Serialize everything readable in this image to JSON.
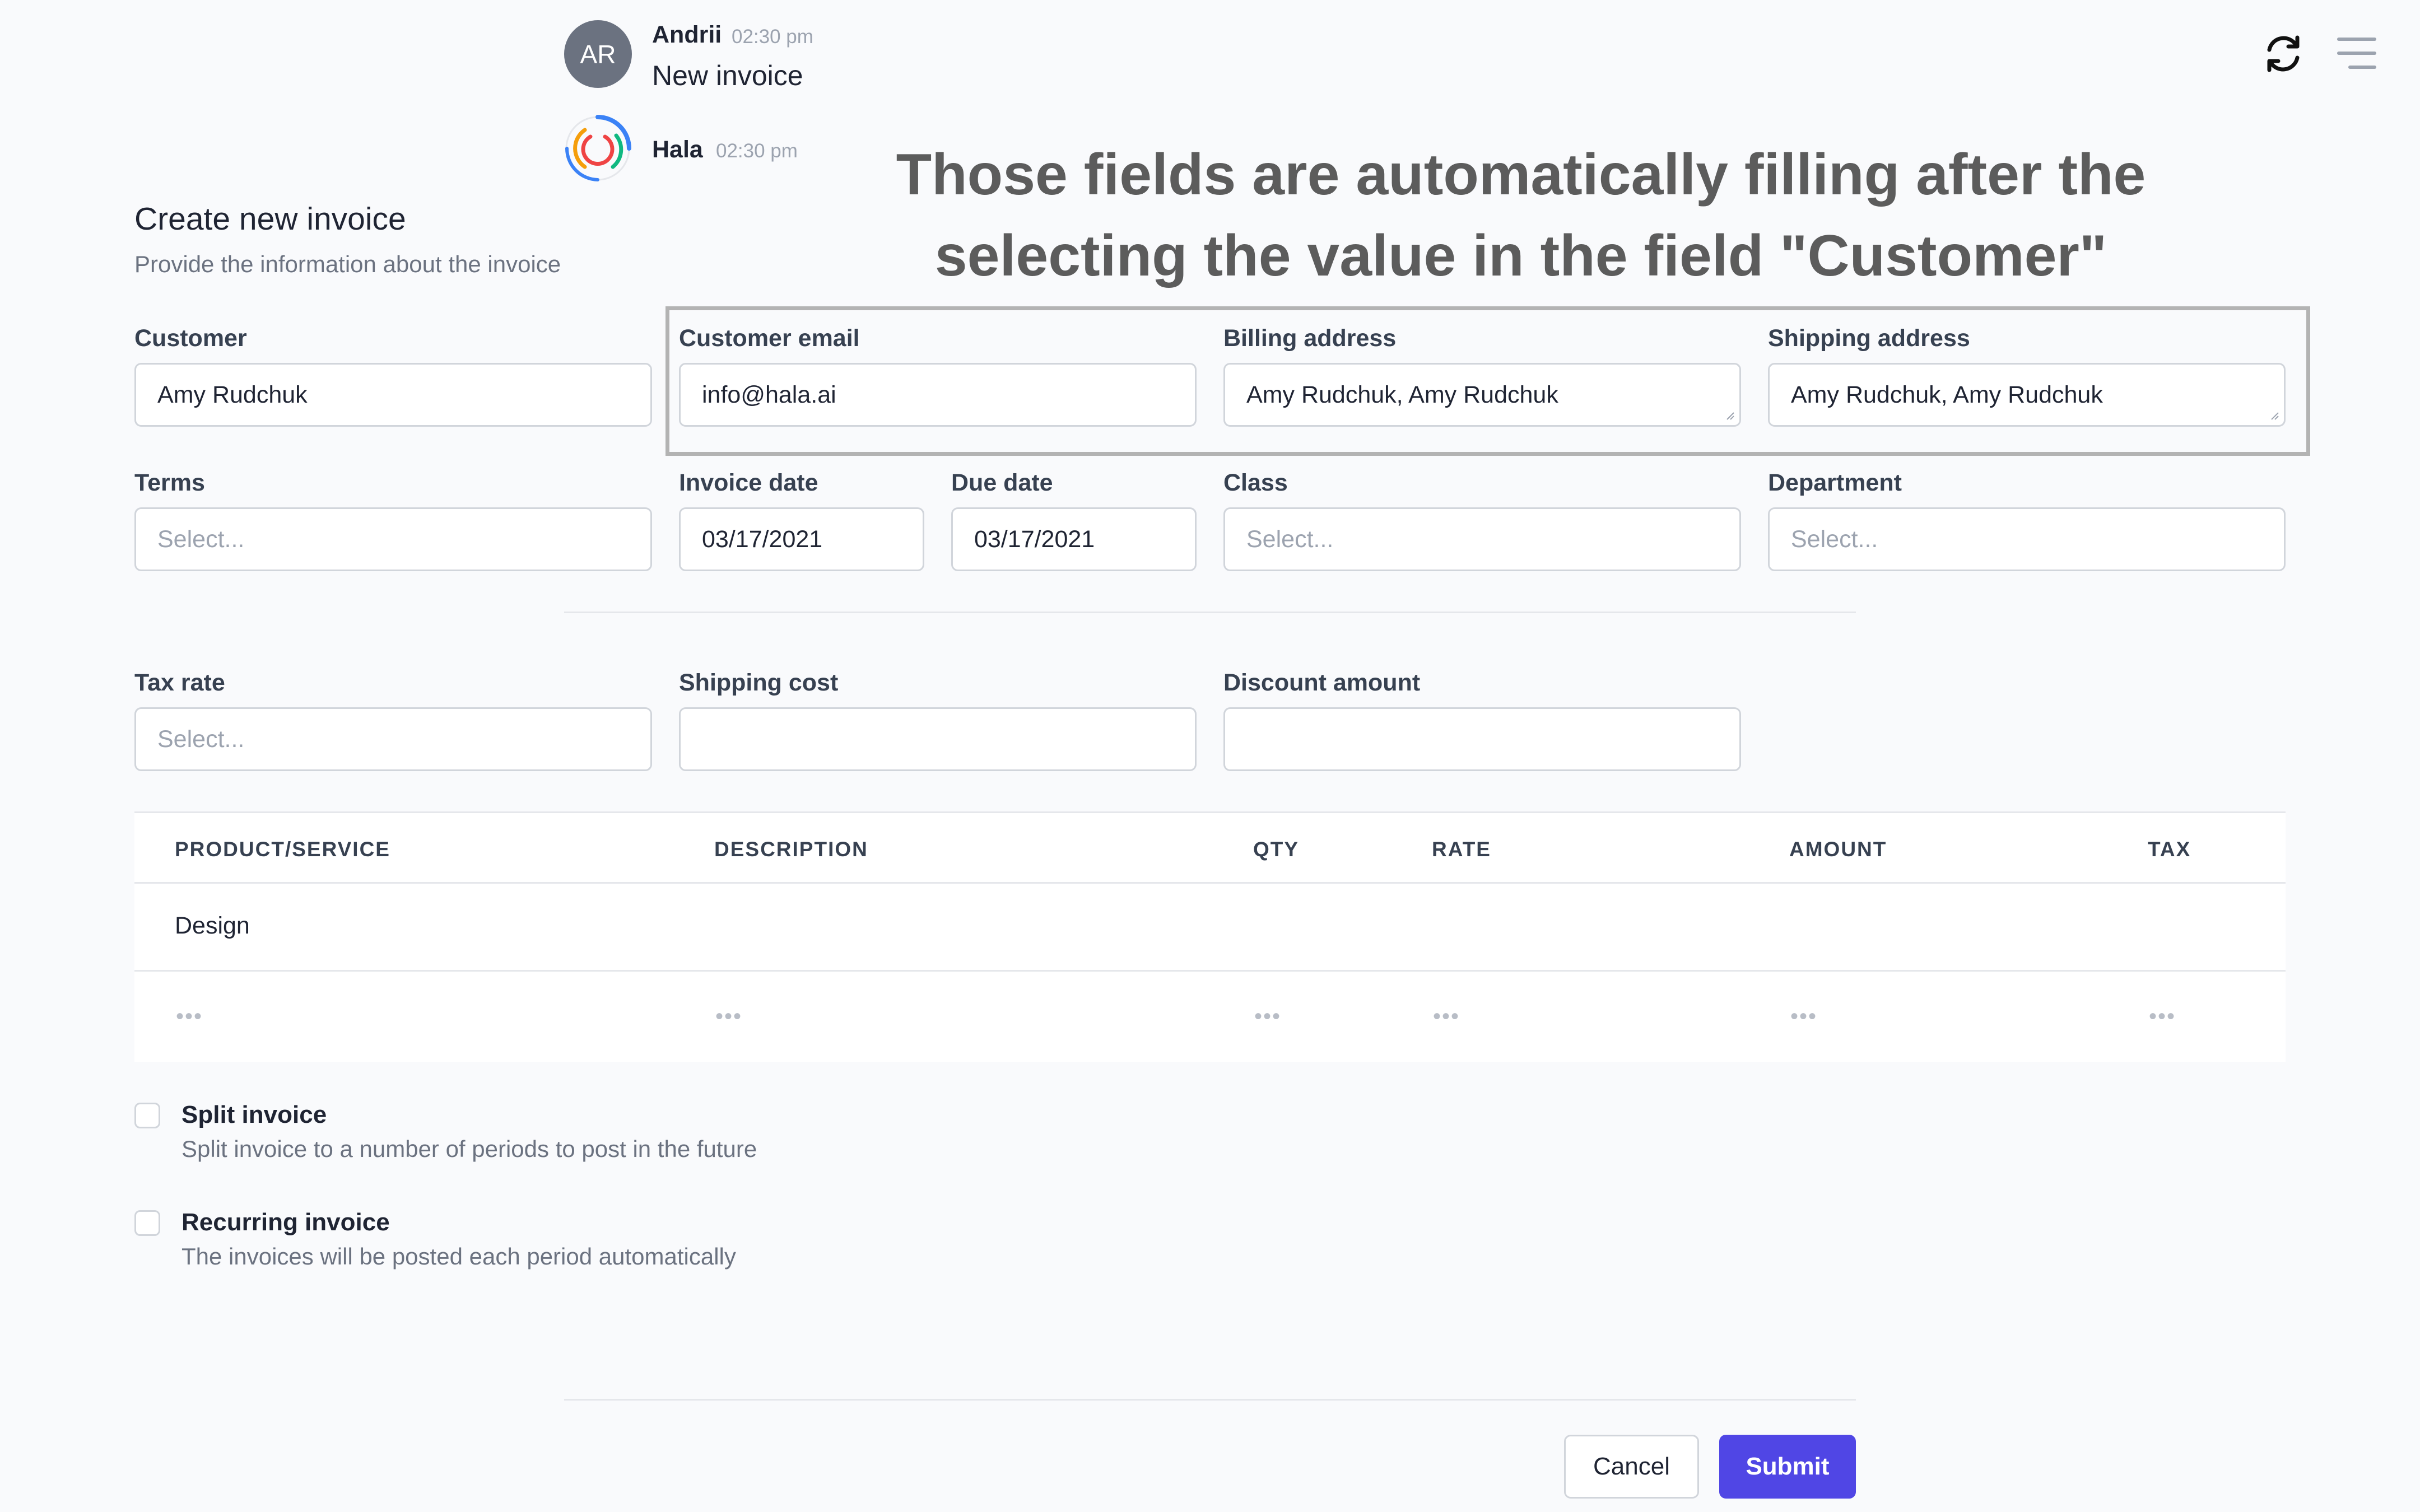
{
  "chat": {
    "andrii": {
      "initials": "AR",
      "name": "Andrii",
      "time": "02:30 pm",
      "message": "New invoice"
    },
    "hala": {
      "name": "Hala",
      "time": "02:30 pm"
    }
  },
  "annotation": {
    "line1": "Those fields are automatically filling after the",
    "line2": "selecting the value in the field \"Customer\""
  },
  "form": {
    "title": "Create new invoice",
    "subtitle": "Provide the information about the invoice",
    "customer": {
      "label": "Customer",
      "value": "Amy Rudchuk"
    },
    "customer_email": {
      "label": "Customer email",
      "value": "info@hala.ai"
    },
    "billing_address": {
      "label": "Billing address",
      "value": "Amy Rudchuk, Amy Rudchuk"
    },
    "shipping_address": {
      "label": "Shipping address",
      "value": "Amy Rudchuk, Amy Rudchuk"
    },
    "terms": {
      "label": "Terms",
      "placeholder": "Select..."
    },
    "invoice_date": {
      "label": "Invoice date",
      "value": "03/17/2021"
    },
    "due_date": {
      "label": "Due date",
      "value": "03/17/2021"
    },
    "class": {
      "label": "Class",
      "placeholder": "Select..."
    },
    "department": {
      "label": "Department",
      "placeholder": "Select..."
    },
    "tax_rate": {
      "label": "Tax rate",
      "placeholder": "Select..."
    },
    "shipping_cost": {
      "label": "Shipping cost",
      "value": ""
    },
    "discount_amount": {
      "label": "Discount amount",
      "value": ""
    }
  },
  "table": {
    "columns": [
      "PRODUCT/SERVICE",
      "DESCRIPTION",
      "QTY",
      "RATE",
      "AMOUNT",
      "TAX"
    ],
    "rows": [
      {
        "product": "Design"
      }
    ],
    "placeholder": "•••"
  },
  "options": {
    "split": {
      "label": "Split invoice",
      "description": "Split invoice to a number of periods to post in the future"
    },
    "recurring": {
      "label": "Recurring invoice",
      "description": "The invoices will be posted each period automatically"
    }
  },
  "buttons": {
    "cancel": "Cancel",
    "submit": "Submit"
  },
  "colors": {
    "accent": "#5046e5",
    "annotation_text": "#5c5c5c"
  },
  "icons": {
    "refresh": "refresh-icon",
    "menu": "menu-icon",
    "hala_logo": "hala-logo-icon"
  }
}
